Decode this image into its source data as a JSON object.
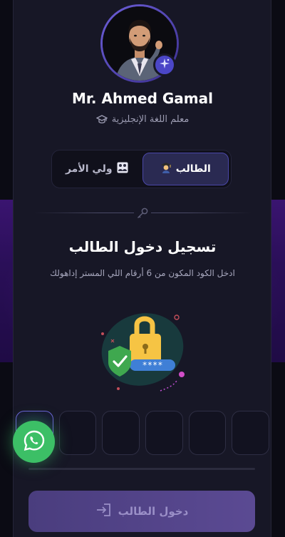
{
  "profile": {
    "name": "Mr. Ahmed Gamal",
    "role": "معلم اللغة الإنجليزية"
  },
  "tabs": [
    {
      "label": "الطالب",
      "icon": "student-icon",
      "active": true
    },
    {
      "label": "ولي الأمر",
      "icon": "family-icon",
      "active": false
    }
  ],
  "login": {
    "title": "تسجيل دخول الطالب",
    "description": "ادخل الكود المكون من 6 أرقام اللي المستر إداهولك",
    "code_length": 6,
    "code_digits": [
      "",
      "",
      "",
      "",
      "",
      ""
    ],
    "submit_label": "دخول الطالب"
  },
  "illustration": {
    "password_mask": "****",
    "icon": "padlock-shield-icon"
  },
  "colors": {
    "accent": "#4b46c7",
    "card_bg": "#171726",
    "band": "#2a0f58",
    "whatsapp": "#3cbf66"
  }
}
